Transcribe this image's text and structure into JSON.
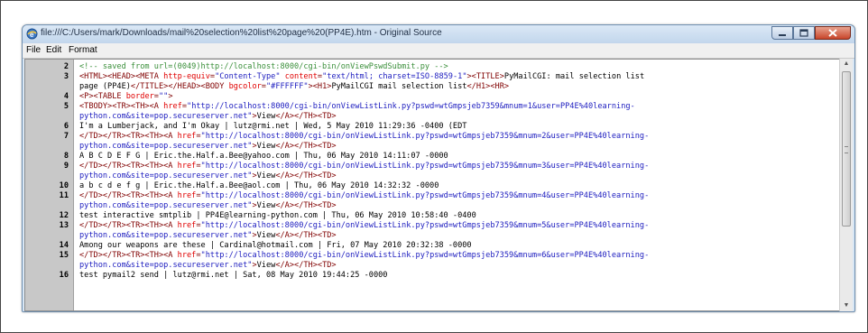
{
  "window": {
    "title": "file:///C:/Users/mark/Downloads/mail%20selection%20list%20page%20(PP4E).htm - Original Source"
  },
  "menu": [
    "File",
    "Edit",
    "Format"
  ],
  "lines": [
    {
      "n": "2",
      "parts": [
        [
          "c",
          "<!-- saved from url=(0049)http://localhost:8000/cgi-bin/onViewPswdSubmit.py -->"
        ]
      ]
    },
    {
      "n": "3",
      "parts": [
        [
          "t",
          "<HTML><HEAD><META "
        ],
        [
          "a",
          "http-equiv"
        ],
        [
          "t",
          "="
        ],
        [
          "v",
          "\"Content-Type\""
        ],
        [
          "t",
          " "
        ],
        [
          "a",
          "content"
        ],
        [
          "t",
          "="
        ],
        [
          "v",
          "\"text/html; charset=ISO-8859-1\""
        ],
        [
          "t",
          "><TITLE>"
        ],
        [
          "x",
          "PyMailCGI: mail selection list"
        ]
      ]
    },
    {
      "n": "",
      "parts": [
        [
          "x",
          "page (PP4E)"
        ],
        [
          "t",
          "</TITLE></HEAD><BODY "
        ],
        [
          "a",
          "bgcolor"
        ],
        [
          "t",
          "="
        ],
        [
          "v",
          "\"#FFFFFF\""
        ],
        [
          "t",
          "><H1>"
        ],
        [
          "x",
          "PyMailCGI mail selection list"
        ],
        [
          "t",
          "</H1><HR>"
        ]
      ]
    },
    {
      "n": "4",
      "parts": [
        [
          "t",
          "<P><TABLE "
        ],
        [
          "a",
          "border"
        ],
        [
          "t",
          "="
        ],
        [
          "v",
          "\"\""
        ],
        [
          "t",
          ">"
        ]
      ]
    },
    {
      "n": "5",
      "parts": [
        [
          "t",
          "<TBODY><TR><TH><A "
        ],
        [
          "a",
          "href"
        ],
        [
          "t",
          "="
        ],
        [
          "v",
          "\"http://localhost:8000/cgi-bin/onViewListLink.py?pswd=wtGmpsjeb7359&mnum=1&user=PP4E%40learning-"
        ]
      ]
    },
    {
      "n": "",
      "parts": [
        [
          "v",
          "python.com&site=pop.secureserver.net\""
        ],
        [
          "t",
          ">"
        ],
        [
          "x",
          "View"
        ],
        [
          "t",
          "</A></TH><TD>"
        ]
      ]
    },
    {
      "n": "6",
      "parts": [
        [
          "x",
          "I'm a Lumberjack, and I'm Okay | lutz@rmi.net | Wed, 5 May 2010 11:29:36 -0400 (EDT"
        ]
      ]
    },
    {
      "n": "7",
      "parts": [
        [
          "t",
          "</TD></TR><TR><TH><A "
        ],
        [
          "a",
          "href"
        ],
        [
          "t",
          "="
        ],
        [
          "v",
          "\"http://localhost:8000/cgi-bin/onViewListLink.py?pswd=wtGmpsjeb7359&mnum=2&user=PP4E%40learning-"
        ]
      ]
    },
    {
      "n": "",
      "parts": [
        [
          "v",
          "python.com&site=pop.secureserver.net\""
        ],
        [
          "t",
          ">"
        ],
        [
          "x",
          "View"
        ],
        [
          "t",
          "</A></TH><TD>"
        ]
      ]
    },
    {
      "n": "8",
      "parts": [
        [
          "x",
          "A B C D E F G | Eric.the.Half.a.Bee@yahoo.com | Thu, 06 May 2010 14:11:07 -0000"
        ]
      ]
    },
    {
      "n": "9",
      "parts": [
        [
          "t",
          "</TD></TR><TR><TH><A "
        ],
        [
          "a",
          "href"
        ],
        [
          "t",
          "="
        ],
        [
          "v",
          "\"http://localhost:8000/cgi-bin/onViewListLink.py?pswd=wtGmpsjeb7359&mnum=3&user=PP4E%40learning-"
        ]
      ]
    },
    {
      "n": "",
      "parts": [
        [
          "v",
          "python.com&site=pop.secureserver.net\""
        ],
        [
          "t",
          ">"
        ],
        [
          "x",
          "View"
        ],
        [
          "t",
          "</A></TH><TD>"
        ]
      ]
    },
    {
      "n": "10",
      "parts": [
        [
          "x",
          "a b c d e f g | Eric.the.Half.a.Bee@aol.com | Thu, 06 May 2010 14:32:32 -0000"
        ]
      ]
    },
    {
      "n": "11",
      "parts": [
        [
          "t",
          "</TD></TR><TR><TH><A "
        ],
        [
          "a",
          "href"
        ],
        [
          "t",
          "="
        ],
        [
          "v",
          "\"http://localhost:8000/cgi-bin/onViewListLink.py?pswd=wtGmpsjeb7359&mnum=4&user=PP4E%40learning-"
        ]
      ]
    },
    {
      "n": "",
      "parts": [
        [
          "v",
          "python.com&site=pop.secureserver.net\""
        ],
        [
          "t",
          ">"
        ],
        [
          "x",
          "View"
        ],
        [
          "t",
          "</A></TH><TD>"
        ]
      ]
    },
    {
      "n": "12",
      "parts": [
        [
          "x",
          "test interactive smtplib | PP4E@learning-python.com | Thu, 06 May 2010 10:58:40 -0400"
        ]
      ]
    },
    {
      "n": "13",
      "parts": [
        [
          "t",
          "</TD></TR><TR><TH><A "
        ],
        [
          "a",
          "href"
        ],
        [
          "t",
          "="
        ],
        [
          "v",
          "\"http://localhost:8000/cgi-bin/onViewListLink.py?pswd=wtGmpsjeb7359&mnum=5&user=PP4E%40learning-"
        ]
      ]
    },
    {
      "n": "",
      "parts": [
        [
          "v",
          "python.com&site=pop.secureserver.net\""
        ],
        [
          "t",
          ">"
        ],
        [
          "x",
          "View"
        ],
        [
          "t",
          "</A></TH><TD>"
        ]
      ]
    },
    {
      "n": "14",
      "parts": [
        [
          "x",
          "Among our weapons are these | Cardinal@hotmail.com | Fri, 07 May 2010 20:32:38 -0000"
        ]
      ]
    },
    {
      "n": "15",
      "parts": [
        [
          "t",
          "</TD></TR><TR><TH><A "
        ],
        [
          "a",
          "href"
        ],
        [
          "t",
          "="
        ],
        [
          "v",
          "\"http://localhost:8000/cgi-bin/onViewListLink.py?pswd=wtGmpsjeb7359&mnum=6&user=PP4E%40learning-"
        ]
      ]
    },
    {
      "n": "",
      "parts": [
        [
          "v",
          "python.com&site=pop.secureserver.net\""
        ],
        [
          "t",
          ">"
        ],
        [
          "x",
          "View"
        ],
        [
          "t",
          "</A></TH><TD>"
        ]
      ]
    },
    {
      "n": "16",
      "parts": [
        [
          "x",
          "test pymail2 send | lutz@rmi.net | Sat, 08 May 2010 19:44:25 -0000"
        ]
      ]
    }
  ],
  "colors": {
    "comment": "#3a8f3a",
    "tag": "#800000",
    "attr": "#e00000",
    "value": "#2020c0",
    "text": "#000000"
  }
}
